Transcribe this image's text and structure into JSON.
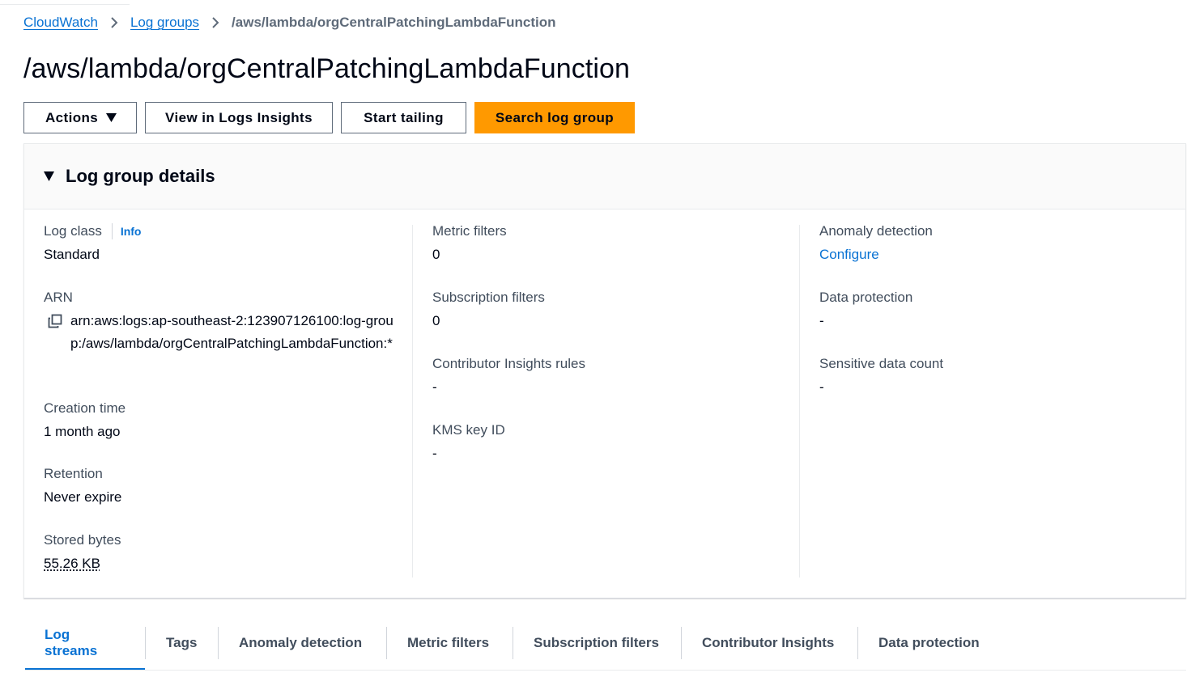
{
  "breadcrumb": {
    "items": [
      {
        "label": "CloudWatch"
      },
      {
        "label": "Log groups"
      },
      {
        "label": "/aws/lambda/orgCentralPatchingLambdaFunction"
      }
    ]
  },
  "page": {
    "title": "/aws/lambda/orgCentralPatchingLambdaFunction"
  },
  "toolbar": {
    "actions_label": "Actions",
    "logs_insights_label": "View in Logs Insights",
    "start_tailing_label": "Start tailing",
    "search_label": "Search log group"
  },
  "details": {
    "title": "Log group details",
    "log_class": {
      "label": "Log class",
      "info": "Info",
      "value": "Standard"
    },
    "arn": {
      "label": "ARN",
      "value": "arn:aws:logs:ap-southeast-2:123907126100:log-group:/aws/lambda/orgCentralPatchingLambdaFunction:*"
    },
    "creation_time": {
      "label": "Creation time",
      "value": "1 month ago"
    },
    "retention": {
      "label": "Retention",
      "value": "Never expire"
    },
    "stored_bytes": {
      "label": "Stored bytes",
      "value": "55.26 KB"
    },
    "metric_filters": {
      "label": "Metric filters",
      "value": "0"
    },
    "subscription_filters": {
      "label": "Subscription filters",
      "value": "0"
    },
    "contributor_insights": {
      "label": "Contributor Insights rules",
      "value": "-"
    },
    "kms_key": {
      "label": "KMS key ID",
      "value": "-"
    },
    "anomaly_detection": {
      "label": "Anomaly detection",
      "value": "Configure"
    },
    "data_protection": {
      "label": "Data protection",
      "value": "-"
    },
    "sensitive_data": {
      "label": "Sensitive data count",
      "value": "-"
    }
  },
  "tabs": [
    {
      "label": "Log streams",
      "active": true
    },
    {
      "label": "Tags"
    },
    {
      "label": "Anomaly detection"
    },
    {
      "label": "Metric filters"
    },
    {
      "label": "Subscription filters"
    },
    {
      "label": "Contributor Insights"
    },
    {
      "label": "Data protection"
    }
  ],
  "icons": {
    "breadcrumb_separator": "chevron-right-icon",
    "actions_caret": "caret-down-icon",
    "panel_toggle": "caret-down-icon",
    "arn_copy": "copy-icon"
  },
  "colors": {
    "link": "#0972d3",
    "primary_button": "#ff9900",
    "text": "#000716",
    "label": "#414d5c"
  }
}
